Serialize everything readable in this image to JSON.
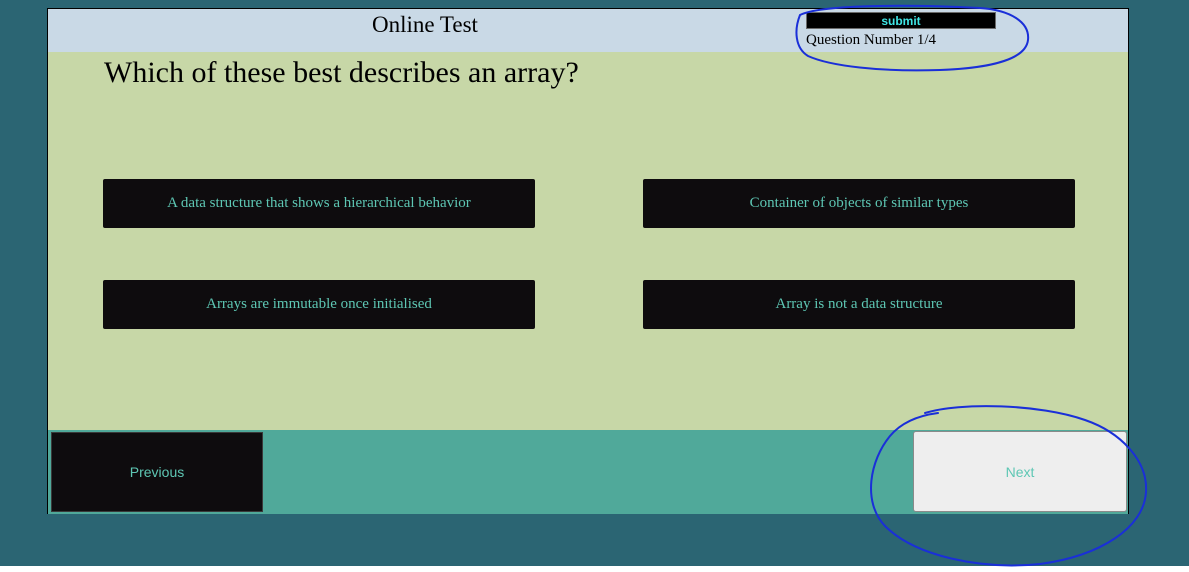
{
  "header": {
    "title": "Online Test",
    "submit_label": "submit",
    "question_counter": "Question Number 1/4"
  },
  "question": {
    "text": "Which of these best describes an array?",
    "options": [
      "A data structure that shows a hierarchical behavior",
      "Container of objects of similar types",
      "Arrays are immutable once initialised",
      "Array is not a data structure"
    ]
  },
  "footer": {
    "previous_label": "Previous",
    "next_label": "Next"
  },
  "colors": {
    "page_background": "#2b6573",
    "quiz_background": "#c7d7a7",
    "header_background": "#c9d9e6",
    "footer_background": "#50a99a",
    "button_dark": "#0e0c0e",
    "button_text": "#5ec7b4",
    "submit_text": "#3fe6e6",
    "annotation_ink": "#1a2fd8"
  }
}
